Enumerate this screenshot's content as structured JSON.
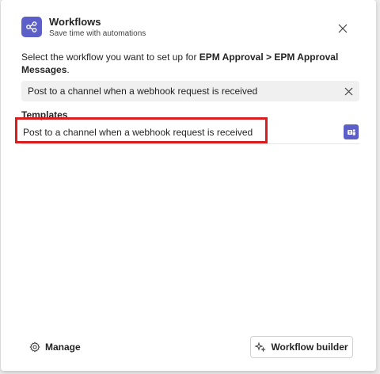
{
  "header": {
    "title": "Workflows",
    "subtitle": "Save time with automations"
  },
  "prompt": {
    "prefix": "Select the workflow you want to set up for ",
    "team": "EPM Approval",
    "separator": " > ",
    "channel": "EPM Approval Messages",
    "suffix": "."
  },
  "search": {
    "value": "Post to a channel when a webhook request is received"
  },
  "templates": {
    "label": "Templates",
    "items": [
      {
        "label": "Post to a channel when a webhook request is received"
      }
    ]
  },
  "footer": {
    "manage_label": "Manage",
    "builder_label": "Workflow builder"
  },
  "colors": {
    "accent": "#5b5fc7",
    "highlight": "#d81e1e"
  },
  "icons": {
    "app": "workflows-icon",
    "close": "close-icon",
    "clear": "clear-icon",
    "template_app": "teams-icon",
    "manage": "gear-icon",
    "builder": "sparkle-icon"
  }
}
